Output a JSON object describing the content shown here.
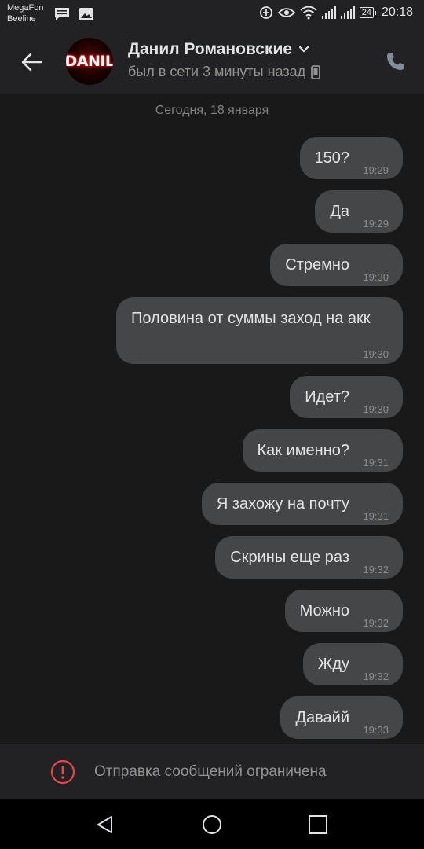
{
  "status_bar": {
    "carrier1": "MegaFon",
    "carrier2": "Beeline",
    "battery": "24",
    "time": "20:18",
    "icons": [
      "message-icon",
      "image-icon",
      "data-saver-icon",
      "eye-icon",
      "wifi-icon",
      "signal-icon",
      "signal-icon",
      "battery-icon"
    ]
  },
  "header": {
    "avatar_text": "DANIL",
    "name": "Данил Романовские",
    "status": "был в сети 3 минуты назад",
    "icons": [
      "back-arrow-icon",
      "chevron-down-icon",
      "phone-icon",
      "call-icon"
    ]
  },
  "chat": {
    "date_separator": "Сегодня, 18 января",
    "messages": [
      {
        "text": "150?",
        "time": "19:29"
      },
      {
        "text": "Да",
        "time": "19:29"
      },
      {
        "text": "Стремно",
        "time": "19:30"
      },
      {
        "text": "Половина от суммы заход на акк",
        "time": "19:30"
      },
      {
        "text": "Идет?",
        "time": "19:30"
      },
      {
        "text": "Как именно?",
        "time": "19:31"
      },
      {
        "text": "Я захожу на почту",
        "time": "19:31"
      },
      {
        "text": "Скрины еще раз",
        "time": "19:32"
      },
      {
        "text": "Можно",
        "time": "19:32"
      },
      {
        "text": "Жду",
        "time": "19:32"
      },
      {
        "text": "Давайй",
        "time": "19:33"
      }
    ]
  },
  "footer": {
    "restricted_text": "Отправка сообщений ограничена",
    "icon": "warning-icon"
  },
  "colors": {
    "background": "#19191a",
    "bubble": "#454647",
    "warning": "#e64646"
  }
}
